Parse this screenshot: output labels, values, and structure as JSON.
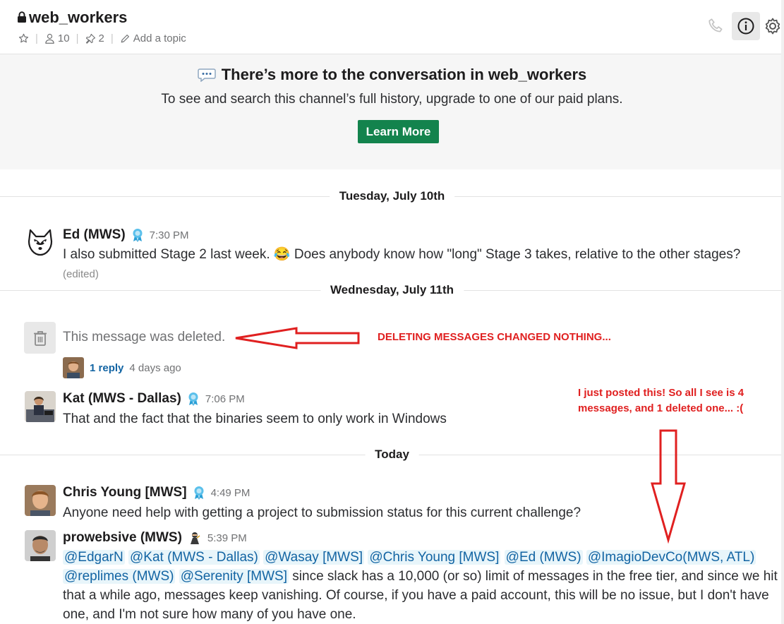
{
  "channel": {
    "name": "web_workers",
    "members_count": "10",
    "pins_count": "2",
    "add_topic": "Add a topic"
  },
  "banner": {
    "title": "There’s more to the conversation in web_workers",
    "subtitle": "To see and search this channel’s full history, upgrade to one of our paid plans.",
    "button": "Learn More"
  },
  "dividers": {
    "d1": "Tuesday, July 10th",
    "d2": "Wednesday, July 11th",
    "d3": "Today"
  },
  "messages": {
    "ed": {
      "author": "Ed (MWS)",
      "time": "7:30 PM",
      "text_a": "I also submitted Stage 2 last week.",
      "emoji": "😂",
      "text_b": "Does anybody know how \"long\" Stage 3 takes, relative to the other stages?",
      "edited": "(edited)"
    },
    "deleted": {
      "text": "This message was deleted.",
      "reply": "1 reply",
      "reply_time": "4 days ago"
    },
    "kat": {
      "author": "Kat (MWS - Dallas)",
      "time": "7:06 PM",
      "text": "That and the fact that the binaries seem to only work in Windows"
    },
    "chris": {
      "author": "Chris Young [MWS]",
      "time": "4:49 PM",
      "text": "Anyone need help with getting a project to submission status for this current challenge?"
    },
    "pro": {
      "author": "prowebsive (MWS)",
      "time": "5:39 PM",
      "mentions": [
        "@EdgarN",
        "@Kat (MWS - Dallas)",
        "@Wasay [MWS]",
        "@Chris Young [MWS]",
        "@Ed (MWS)",
        "@ImagioDevCo(MWS, ATL)",
        "@replimes (MWS)",
        "@Serenity [MWS]"
      ],
      "text": "since slack has a 10,000 (or so) limit of messages in the free tier, and since we hit that a while ago, messages keep vanishing. Of course, if you have a paid account, this will be no issue, but I don't have one, and I'm not sure how many of you have one."
    }
  },
  "annotations": {
    "a1": "DELETING MESSAGES CHANGED NOTHING...",
    "a2_line1": "I just posted this! So all I see is 4",
    "a2_line2": "messages, and 1 deleted one... :("
  },
  "colors": {
    "accent_green": "#13834d",
    "mention_blue": "#1264a3",
    "annotation_red": "#e02020"
  }
}
